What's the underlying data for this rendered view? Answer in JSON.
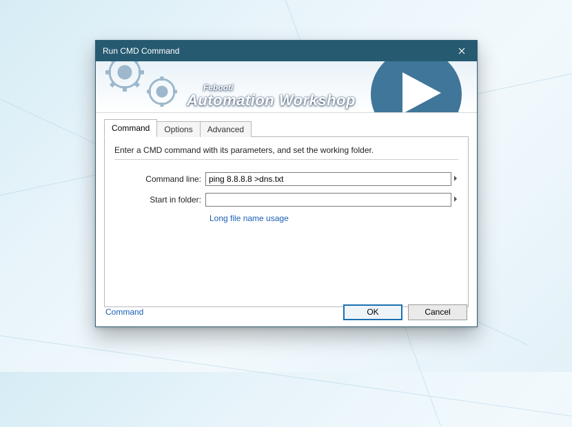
{
  "window": {
    "title": "Run CMD Command"
  },
  "banner": {
    "brand_small": "Febooti",
    "brand_big": "Automation Workshop"
  },
  "tabs": [
    {
      "label": "Command",
      "active": true
    },
    {
      "label": "Options",
      "active": false
    },
    {
      "label": "Advanced",
      "active": false
    }
  ],
  "panel": {
    "instruction": "Enter a CMD command with its parameters, and set the working folder.",
    "command_label": "Command line:",
    "command_value": "ping 8.8.8.8 >dns.txt",
    "folder_label": "Start in folder:",
    "folder_value": "",
    "link": "Long file name usage"
  },
  "footer": {
    "left_link": "Command",
    "ok": "OK",
    "cancel": "Cancel"
  }
}
